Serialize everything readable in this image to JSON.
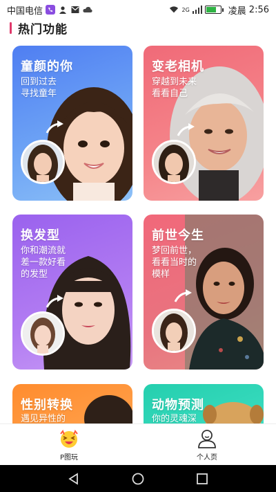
{
  "status_bar": {
    "carrier": "中国电信",
    "signal_tag": "2G",
    "time_prefix": "凌晨",
    "time": "2:56"
  },
  "section": {
    "title": "热门功能"
  },
  "cards": [
    {
      "title": "童颜的你",
      "subtitle": "回到过去\n寻找童年"
    },
    {
      "title": "变老相机",
      "subtitle": "穿越到未来\n看看自己"
    },
    {
      "title": "换发型",
      "subtitle": "你和潮流就\n差一款好看\n的发型"
    },
    {
      "title": "前世今生",
      "subtitle": "梦回前世，\n看看当时的\n模样"
    },
    {
      "title": "性别转换",
      "subtitle": "遇见异性的"
    },
    {
      "title": "动物预测",
      "subtitle": "你的灵魂深"
    }
  ],
  "bottom_nav": {
    "items": [
      {
        "label": "P图玩",
        "icon": "emoji-face-icon",
        "active": true
      },
      {
        "label": "个人页",
        "icon": "person-icon",
        "active": false
      }
    ]
  },
  "colors": {
    "accent": "#e0386a",
    "card1": "#5a8df0",
    "card2": "#f2707a",
    "card3": "#a46cf0",
    "card4": "#ee6f7c",
    "card5": "#ff9a3c",
    "card6": "#2ed3b4"
  }
}
